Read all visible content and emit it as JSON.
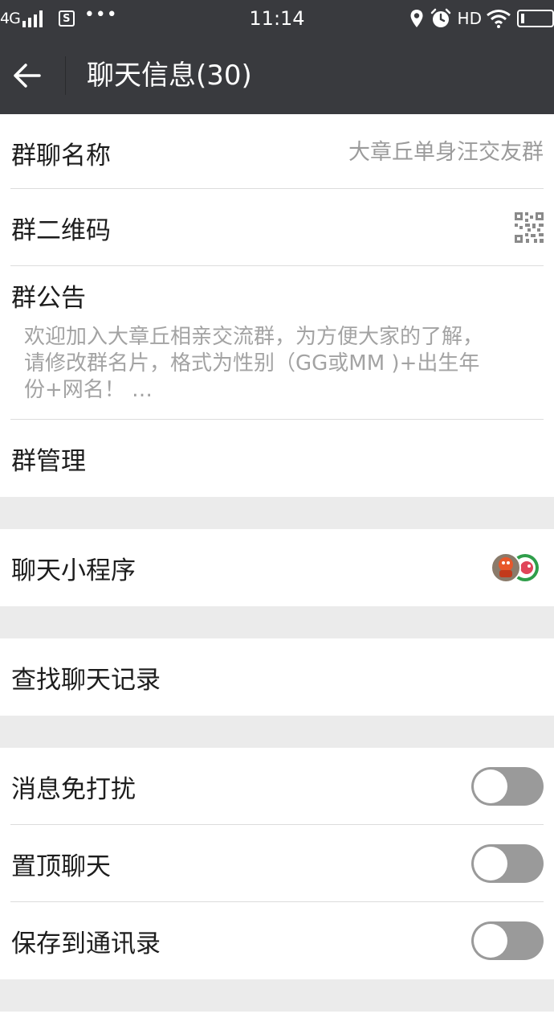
{
  "status_bar": {
    "network": "4G",
    "time": "11:14",
    "hd": "HD"
  },
  "header": {
    "title": "聊天信息(30)"
  },
  "group_info": {
    "name_label": "群聊名称",
    "name_value": "大章丘单身汪交友群",
    "qr_label": "群二维码",
    "announcement_label": "群公告",
    "announcement_lines": [
      "欢迎加入大章丘相亲交流群，为方便大家的了解，",
      "请修改群名片，格式为性别（GG或MM )+出生年",
      "份+网名！ …"
    ],
    "manage_label": "群管理"
  },
  "mini_programs": {
    "label": "聊天小程序"
  },
  "search": {
    "label": "查找聊天记录"
  },
  "settings": {
    "mute_label": "消息免打扰",
    "mute_on": false,
    "pin_label": "置顶聊天",
    "pin_on": false,
    "save_label": "保存到通讯录",
    "save_on": false
  },
  "colors": {
    "bar": "#393a3e",
    "background": "#ebebeb",
    "toggle_off": "#9a9a9a",
    "secondary_text": "#9b9b9b"
  }
}
